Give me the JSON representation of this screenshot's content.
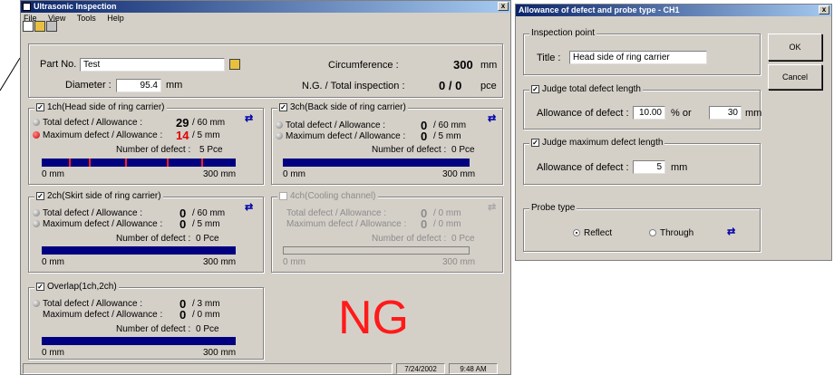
{
  "main": {
    "title": "Ultrasonic Inspection",
    "close": "x",
    "menu": [
      "File",
      "View",
      "Tools",
      "Help"
    ],
    "part_no_label": "Part No.",
    "part_no_value": "Test",
    "diameter_label": "Diameter :",
    "diameter_value": "95.4",
    "diameter_unit": "mm",
    "circumference_label": "Circumference :",
    "circumference_value": "300",
    "circumference_unit": "mm",
    "ng_total_label": "N.G. / Total inspection :",
    "ng_total_value": "0 / 0",
    "ng_total_unit": "pce",
    "result": "NG",
    "status_date": "7/24/2002",
    "status_time": "9:48 AM",
    "channels": {
      "ch1": {
        "title": "1ch(Head side of ring carrier)",
        "total_label": "Total defect / Allowance :",
        "total_value": "29",
        "total_allow": "/  60 mm",
        "max_label": "Maximum defect / Allowance :",
        "max_value": "14",
        "max_allow": "/  5 mm",
        "count_label": "Number of defect :",
        "count_value": "5 Pce",
        "axis_start": "0 mm",
        "axis_end": "300 mm"
      },
      "ch2": {
        "title": "2ch(Skirt side of ring carrier)",
        "total_label": "Total defect / Allowance :",
        "total_value": "0",
        "total_allow": "/  60 mm",
        "max_label": "Maximum defect / Allowance :",
        "max_value": "0",
        "max_allow": "/  5 mm",
        "count_label": "Number of defect :",
        "count_value": "0 Pce",
        "axis_start": "0 mm",
        "axis_end": "300 mm"
      },
      "ch3": {
        "title": "3ch(Back side of ring carrier)",
        "total_label": "Total defect / Allowance :",
        "total_value": "0",
        "total_allow": "/  60 mm",
        "max_label": "Maximum defect / Allowance :",
        "max_value": "0",
        "max_allow": "/  5 mm",
        "count_label": "Number of defect :",
        "count_value": "0 Pce",
        "axis_start": "0 mm",
        "axis_end": "300 mm"
      },
      "ch4": {
        "title": "4ch(Cooling channel)",
        "total_label": "Total defect / Allowance :",
        "total_value": "0",
        "total_allow": "/  0 mm",
        "max_label": "Maximum defect / Allowance :",
        "max_value": "0",
        "max_allow": "/  0 mm",
        "count_label": "Number of defect :",
        "count_value": "0 Pce",
        "axis_start": "0 mm",
        "axis_end": "300 mm"
      },
      "overlap": {
        "title": "Overlap(1ch,2ch)",
        "total_label": "Total defect / Allowance :",
        "total_value": "0",
        "total_allow": "/  3 mm",
        "max_label": "Maximum defect / Allowance :",
        "max_value": "0",
        "max_allow": "/  0 mm",
        "count_label": "Number of defect :",
        "count_value": "0 Pce",
        "axis_start": "0 mm",
        "axis_end": "300 mm"
      }
    }
  },
  "dialog": {
    "title": "Allowance of defect and probe type - CH1",
    "close": "x",
    "inspection_point_label": "Inspection point",
    "title_label": "Title :",
    "title_value": "Head side of ring carrier",
    "judge_total_label": "Judge total defect length",
    "allowance_label": "Allowance of defect :",
    "allowance_pct": "10.00",
    "pct_or": "%   or",
    "allowance_mm": "30",
    "mm": "mm",
    "judge_max_label": "Judge maximum defect length",
    "allowance_max_label": "Allowance of defect :",
    "allowance_max_value": "5",
    "allowance_max_unit": "mm",
    "probe_type_label": "Probe type",
    "reflect_label": "Reflect",
    "through_label": "Through",
    "ok_label": "OK",
    "cancel_label": "Cancel"
  }
}
